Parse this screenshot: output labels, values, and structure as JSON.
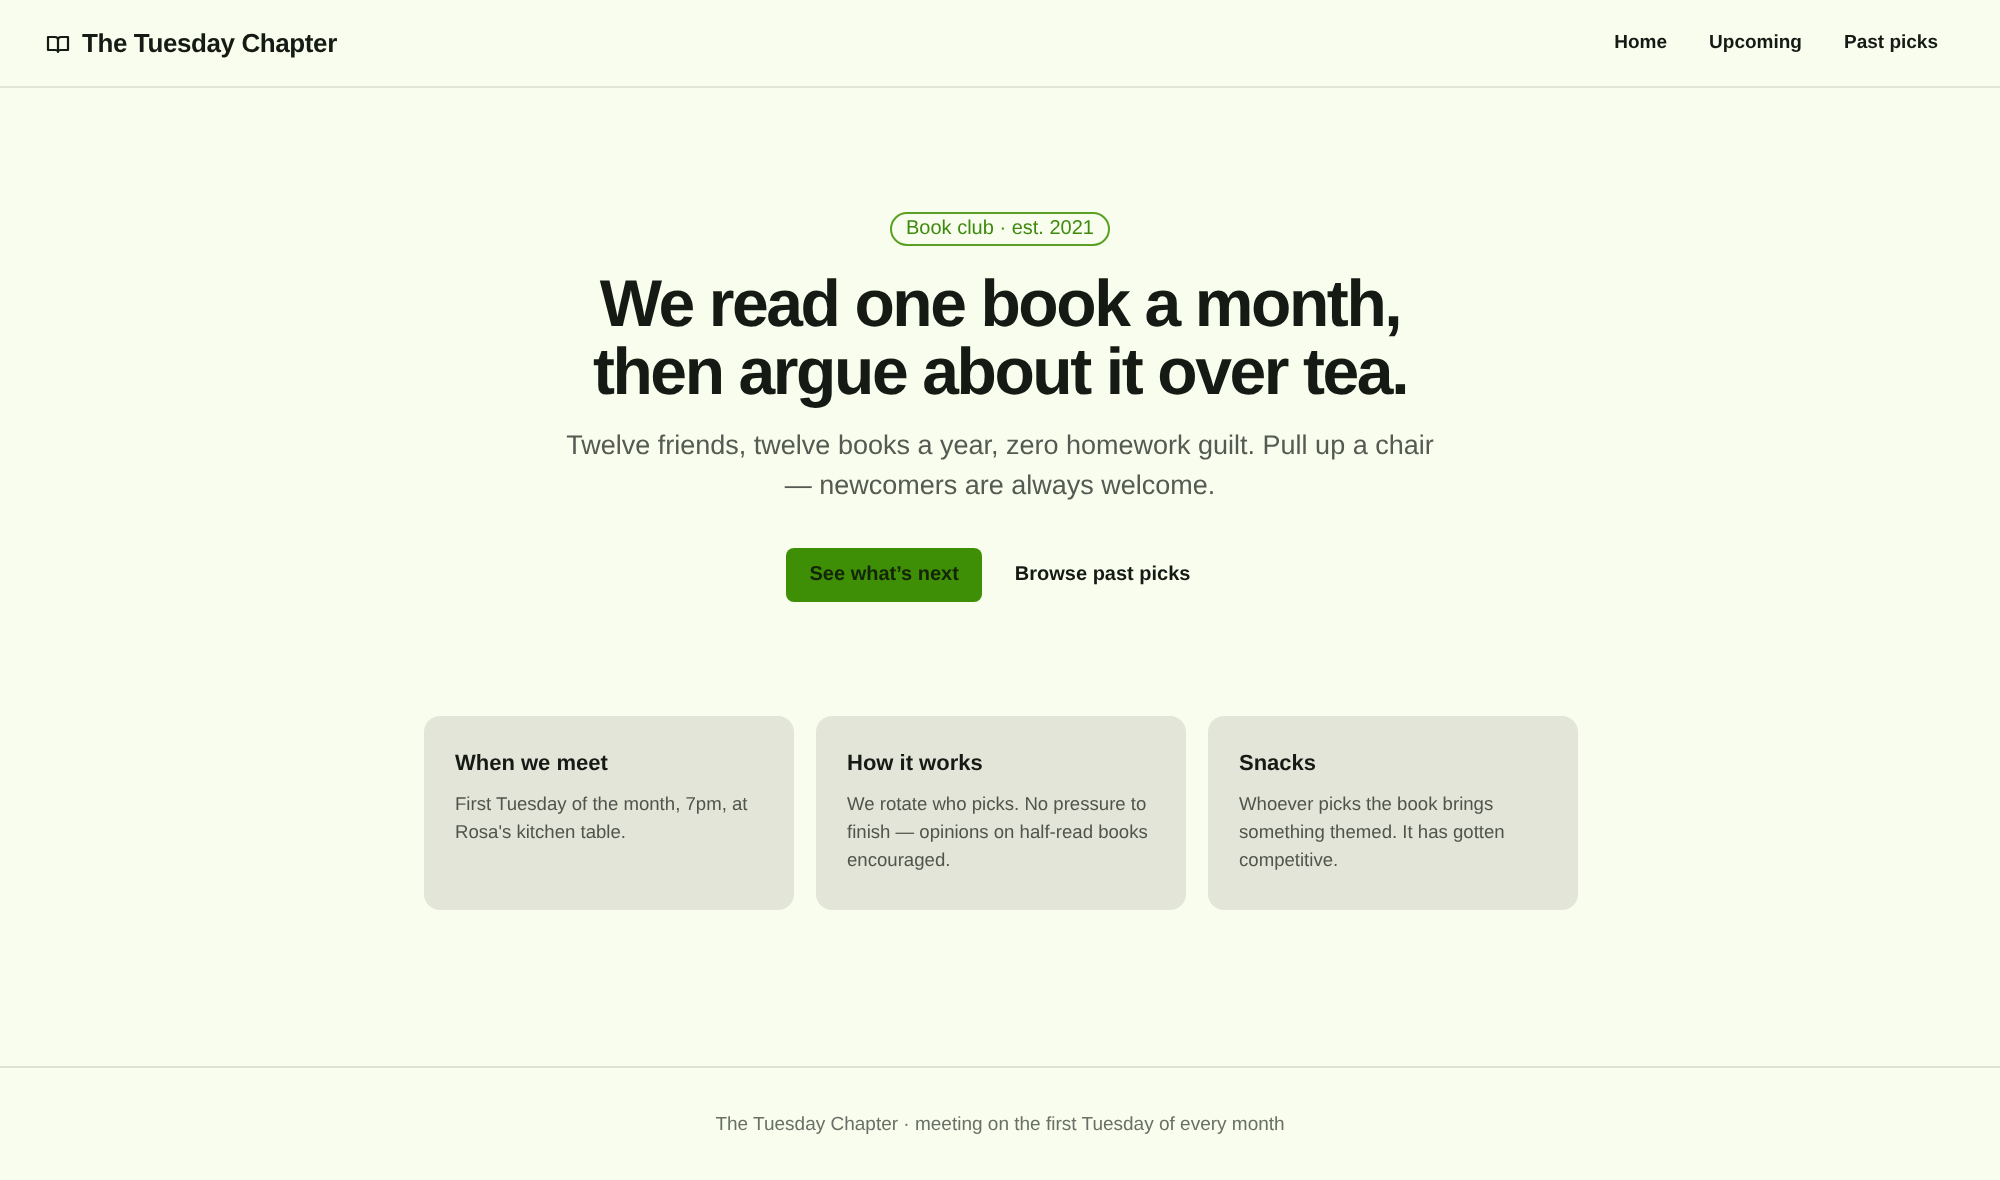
{
  "header": {
    "brand": "The Tuesday Chapter",
    "nav": [
      {
        "label": "Home"
      },
      {
        "label": "Upcoming"
      },
      {
        "label": "Past picks"
      }
    ]
  },
  "hero": {
    "badge": "Book club · est. 2021",
    "title_lines": [
      "We read one book a month,",
      "then argue about it over tea."
    ],
    "subtitle": "Twelve friends, twelve books a year, zero homework guilt. Pull up a chair — newcomers are always welcome.",
    "buttons": [
      {
        "label": "See what’s next",
        "kind": "primary"
      },
      {
        "label": "Browse past picks",
        "kind": "plain"
      }
    ]
  },
  "cards": [
    {
      "title": "When we meet",
      "text": "First Tuesday of the month, 7pm, at Rosa's kitchen table."
    },
    {
      "title": "How it works",
      "text": "We rotate who picks. No pressure to finish — opinions on half-read books encouraged."
    },
    {
      "title": "Snacks",
      "text": "Whoever picks the book brings something themed. It has gotten competitive."
    }
  ],
  "footer": "The Tuesday Chapter · meeting on the first Tuesday of every month"
}
